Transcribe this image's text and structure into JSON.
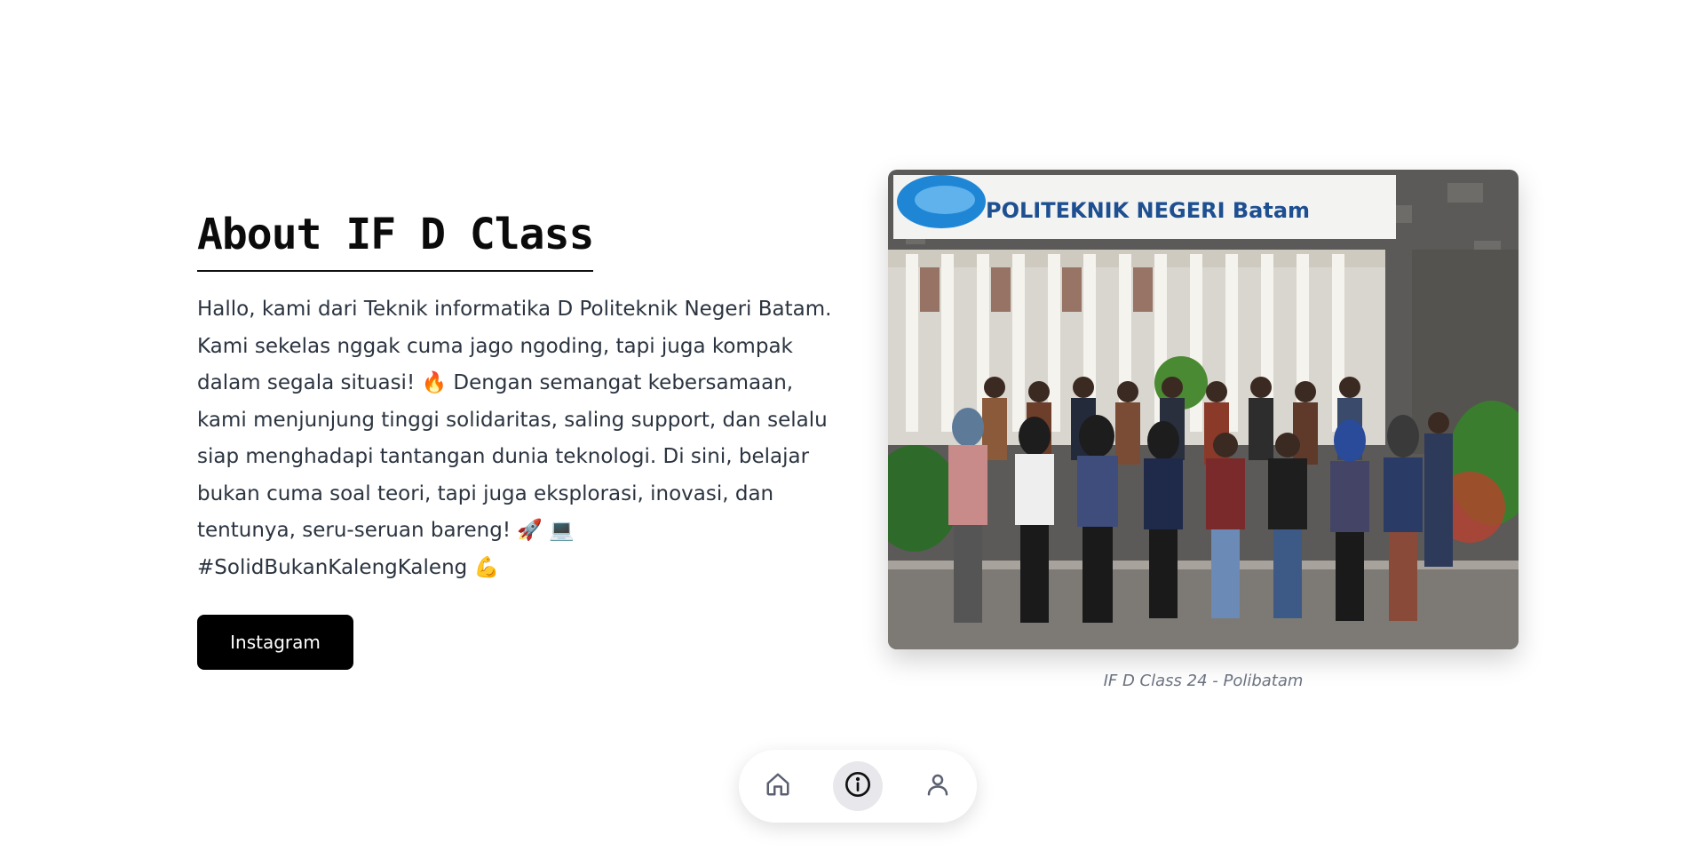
{
  "about": {
    "title": "About IF D Class",
    "description": "Hallo, kami dari Teknik informatika D Politeknik Negeri Batam. Kami sekelas nggak cuma jago ngoding, tapi juga kompak dalam segala situasi! 🔥 Dengan semangat kebersamaan, kami menjunjung tinggi solidaritas, saling support, dan selalu siap menghadapi tantangan dunia teknologi. Di sini, belajar bukan cuma soal teori, tapi juga eksplorasi, inovasi, dan tentunya, seru-seruan bareng! 🚀 💻 #SolidBukanKalengKaleng 💪",
    "button_label": "Instagram"
  },
  "photo": {
    "sign_text": "POLITEKNIK NEGERI Batam",
    "caption": "IF D Class 24 - Polibatam"
  },
  "nav": {
    "items": [
      {
        "name": "home",
        "icon": "home-icon",
        "active": false
      },
      {
        "name": "about",
        "icon": "info-icon",
        "active": true
      },
      {
        "name": "profile",
        "icon": "user-icon",
        "active": false
      }
    ]
  },
  "colors": {
    "button_bg": "#000000",
    "active_nav_bg": "#e8e8ec",
    "caption": "#6b7280"
  }
}
